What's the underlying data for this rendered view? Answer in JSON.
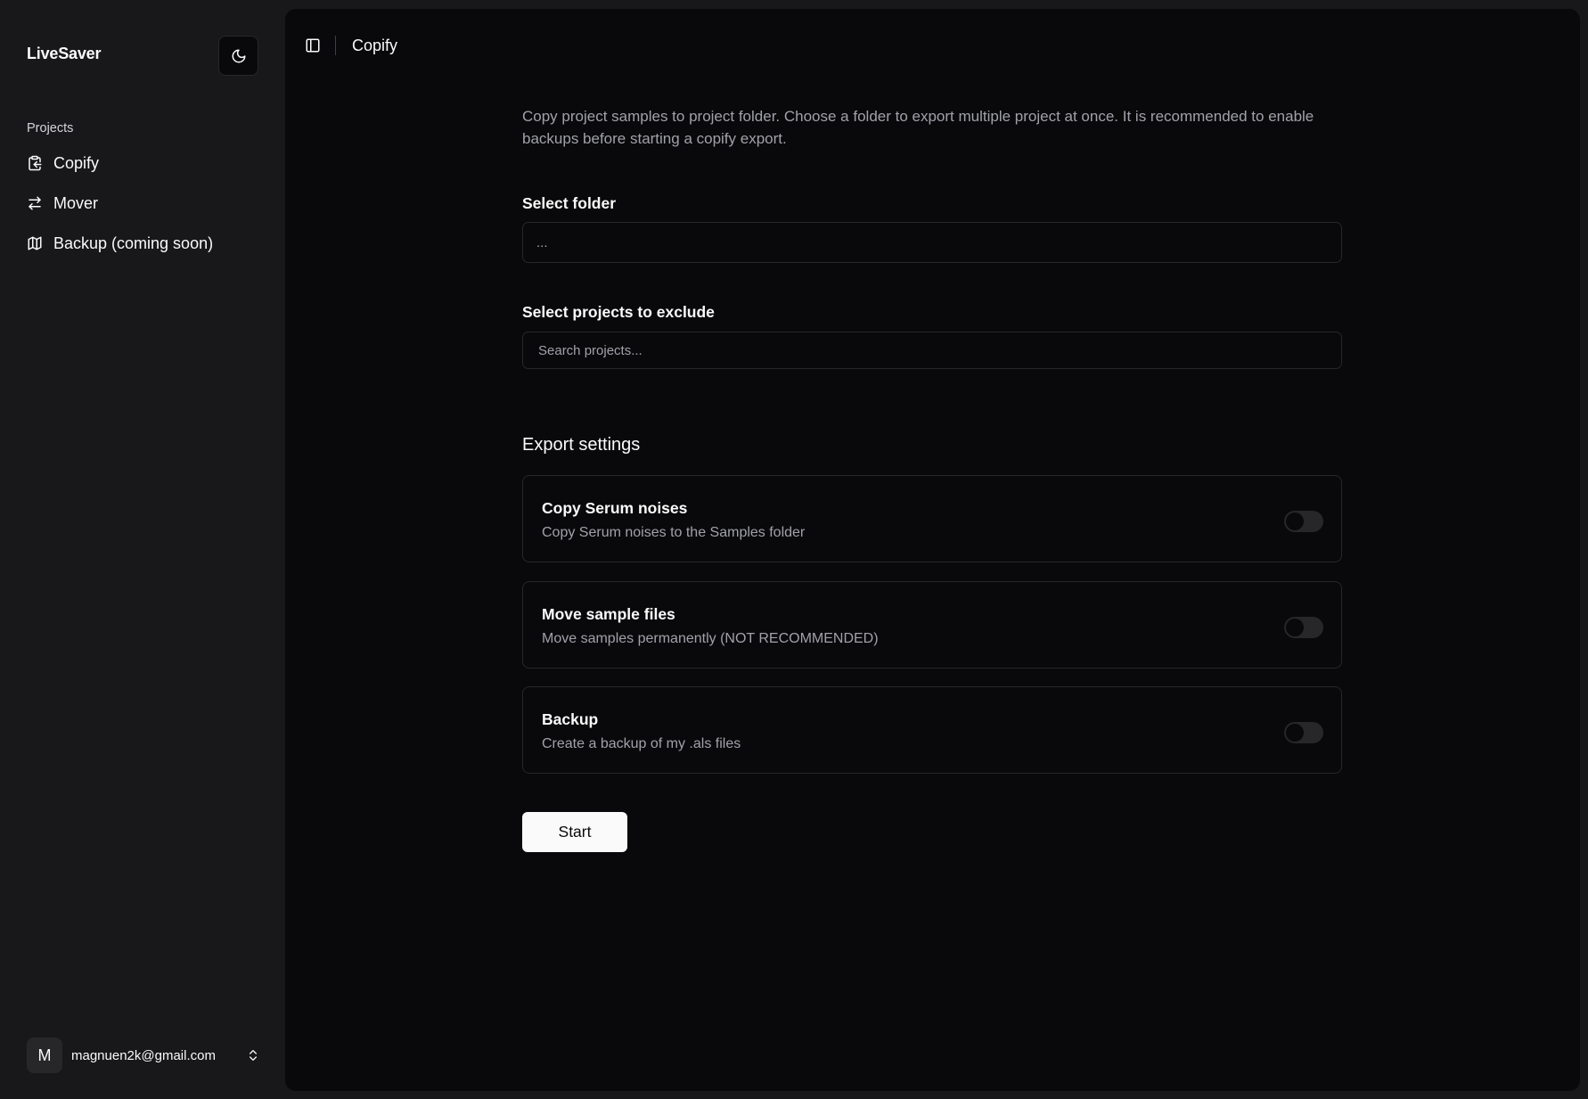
{
  "app": {
    "brand": "LiveSaver",
    "theme_icon": "moon-icon"
  },
  "sidebar": {
    "section_label": "Projects",
    "items": [
      {
        "label": "Copify",
        "icon": "clipboard-copy-icon"
      },
      {
        "label": "Mover",
        "icon": "arrows-left-right-icon"
      },
      {
        "label": "Backup (coming soon)",
        "icon": "map-icon"
      }
    ],
    "user": {
      "avatar_initial": "M",
      "email": "magnuen2k@gmail.com",
      "icon": "chevrons-up-down-icon"
    }
  },
  "header": {
    "toggle_icon": "panel-left-icon",
    "title": "Copify"
  },
  "main": {
    "intro": "Copy project samples to project folder. Choose a folder to export multiple project at once. It is recommended to enable backups before starting a copify export.",
    "folder": {
      "label": "Select folder",
      "value": "..."
    },
    "exclude": {
      "label": "Select projects to exclude",
      "placeholder": "Search projects..."
    },
    "export_settings": {
      "heading": "Export settings",
      "options": [
        {
          "title": "Copy Serum noises",
          "description": "Copy Serum noises to the Samples folder",
          "enabled": false
        },
        {
          "title": "Move sample files",
          "description": "Move samples permanently (NOT RECOMMENDED)",
          "enabled": false
        },
        {
          "title": "Backup",
          "description": "Create a backup of my .als files",
          "enabled": false
        }
      ]
    },
    "start_label": "Start"
  },
  "colors": {
    "sidebar_bg": "#18181b",
    "main_bg": "#09090b",
    "border": "#27272a",
    "muted_text": "#a1a1aa",
    "primary_button": "#fafafa"
  }
}
